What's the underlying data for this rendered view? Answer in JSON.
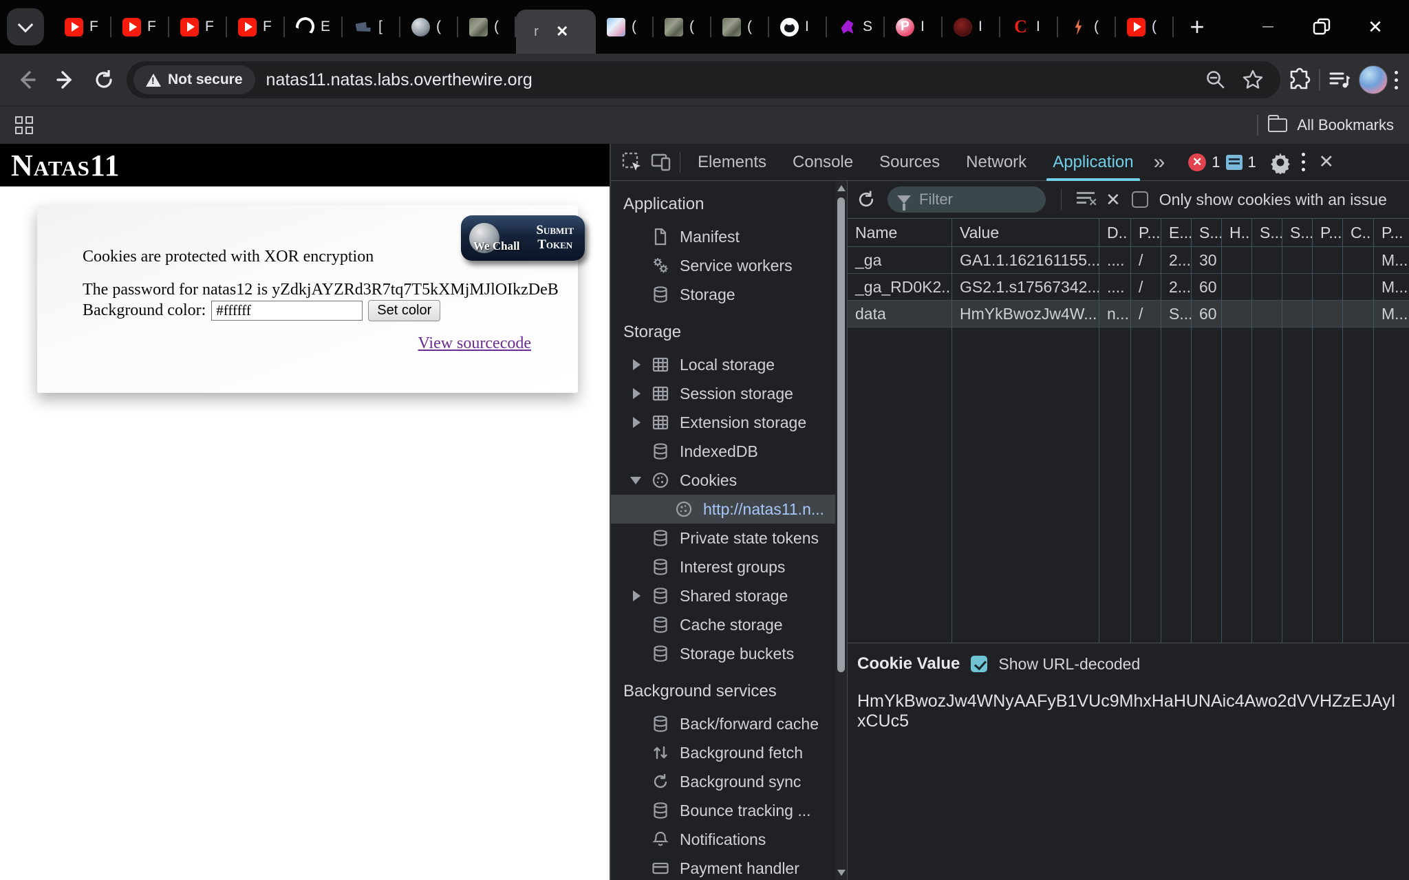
{
  "browser": {
    "tabs": [
      {
        "favicon": "youtube",
        "title": "F"
      },
      {
        "favicon": "youtube",
        "title": "F"
      },
      {
        "favicon": "youtube",
        "title": "F"
      },
      {
        "favicon": "youtube",
        "title": "F"
      },
      {
        "favicon": "chatgpt",
        "title": "E"
      },
      {
        "favicon": "camera",
        "title": "["
      },
      {
        "favicon": "globe",
        "title": "("
      },
      {
        "favicon": "cat",
        "title": "("
      },
      {
        "favicon": "natas",
        "title": "r",
        "active": true
      },
      {
        "favicon": "anime",
        "title": "("
      },
      {
        "favicon": "cat",
        "title": "("
      },
      {
        "favicon": "cat",
        "title": "("
      },
      {
        "favicon": "github",
        "title": "I"
      },
      {
        "favicon": "phantom",
        "title": "S"
      },
      {
        "favicon": "pinterest",
        "title": "I"
      },
      {
        "favicon": "skull",
        "title": "I"
      },
      {
        "favicon": "c-logo",
        "title": "I"
      },
      {
        "favicon": "bolt",
        "title": "("
      },
      {
        "favicon": "youtube",
        "title": "("
      }
    ],
    "new_tab_symbol": "+",
    "active_tab_close": "✕",
    "window_controls": {
      "minimize": "—",
      "close": "✕"
    },
    "toolbar": {
      "not_secure": "Not secure",
      "url": "natas11.natas.labs.overthewire.org"
    },
    "bookmarks_bar": {
      "all_bookmarks": "All Bookmarks"
    }
  },
  "page": {
    "site_title": "Natas11",
    "wechall": {
      "name": "We Chall",
      "action_line1": "Submit",
      "action_line2": "Token"
    },
    "intro": "Cookies are protected with XOR encryption",
    "password_line": "The password for natas12 is yZdkjAYZRd3R7tq7T5kXMjMJlOIkzDeB",
    "background_label": "Background color:",
    "background_value": "#ffffff",
    "set_color": "Set color",
    "view_sourcecode": "View sourcecode"
  },
  "devtools": {
    "tabs": [
      "Elements",
      "Console",
      "Sources",
      "Network",
      "Application"
    ],
    "active_tab": "Application",
    "more_tabs_symbol": "»",
    "error_count": "1",
    "message_count": "1",
    "close_symbol": "✕",
    "sidebar_sections": [
      {
        "title": "Application",
        "items": [
          {
            "label": "Manifest",
            "icon": "file"
          },
          {
            "label": "Service workers",
            "icon": "gears"
          },
          {
            "label": "Storage",
            "icon": "database"
          }
        ]
      },
      {
        "title": "Storage",
        "items": [
          {
            "label": "Local storage",
            "icon": "table",
            "arrow": "right"
          },
          {
            "label": "Session storage",
            "icon": "table",
            "arrow": "right"
          },
          {
            "label": "Extension storage",
            "icon": "table",
            "arrow": "right"
          },
          {
            "label": "IndexedDB",
            "icon": "database"
          },
          {
            "label": "Cookies",
            "icon": "cookie",
            "arrow": "down"
          },
          {
            "label": "http://natas11.n...",
            "icon": "cookie",
            "selected": true,
            "indent": true
          },
          {
            "label": "Private state tokens",
            "icon": "database"
          },
          {
            "label": "Interest groups",
            "icon": "database"
          },
          {
            "label": "Shared storage",
            "icon": "database",
            "arrow": "right"
          },
          {
            "label": "Cache storage",
            "icon": "database"
          },
          {
            "label": "Storage buckets",
            "icon": "database"
          }
        ]
      },
      {
        "title": "Background services",
        "items": [
          {
            "label": "Back/forward cache",
            "icon": "database"
          },
          {
            "label": "Background fetch",
            "icon": "fetch"
          },
          {
            "label": "Background sync",
            "icon": "sync"
          },
          {
            "label": "Bounce tracking ...",
            "icon": "database"
          },
          {
            "label": "Notifications",
            "icon": "bell"
          },
          {
            "label": "Payment handler",
            "icon": "card"
          }
        ]
      }
    ],
    "filter_placeholder": "Filter",
    "only_show_label": "Only show cookies with an issue",
    "cookie_table": {
      "columns": [
        "Name",
        "Value",
        "D..",
        "P...",
        "E...",
        "S...",
        "H..",
        "S...",
        "S...",
        "P...",
        "C..",
        "P..."
      ],
      "rows": [
        {
          "selected": false,
          "cells": [
            "_ga",
            "GA1.1.162161155...",
            "....",
            "/",
            "2...",
            "30",
            "",
            "",
            "",
            "",
            "",
            "M..."
          ]
        },
        {
          "selected": false,
          "cells": [
            "_ga_RD0K2...",
            "GS2.1.s17567342...",
            "....",
            "/",
            "2...",
            "60",
            "",
            "",
            "",
            "",
            "",
            "M..."
          ]
        },
        {
          "selected": true,
          "cells": [
            "data",
            "HmYkBwozJw4W...",
            "n...",
            "/",
            "S...",
            "60",
            "",
            "",
            "",
            "",
            "",
            "M..."
          ]
        }
      ]
    },
    "cookie_value_panel": {
      "title": "Cookie Value",
      "show_url_decoded": "Show URL-decoded",
      "value": "HmYkBwozJw4WNyAAFyB1VUc9MhxHaHUNAic4Awo2dVVHZzEJAyIxCUc5"
    }
  }
}
